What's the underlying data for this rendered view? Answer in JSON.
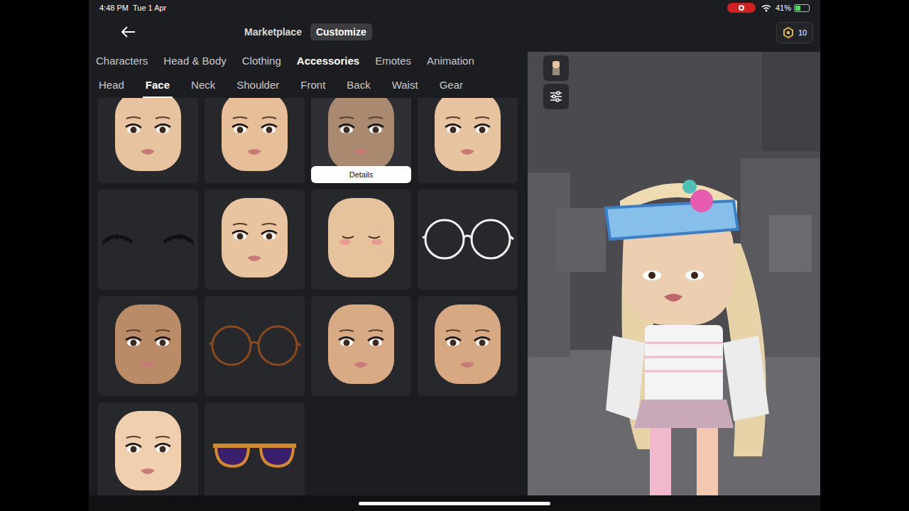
{
  "status_bar": {
    "time": "4:48 PM",
    "date": "Tue 1 Apr",
    "battery": "41%",
    "battery_level": 0.41,
    "recording": true
  },
  "header": {
    "modes": [
      {
        "label": "Marketplace",
        "selected": false
      },
      {
        "label": "Customize",
        "selected": true
      }
    ],
    "robux": "10"
  },
  "categories": [
    {
      "label": "Characters",
      "selected": false
    },
    {
      "label": "Head & Body",
      "selected": false
    },
    {
      "label": "Clothing",
      "selected": false
    },
    {
      "label": "Accessories",
      "selected": true
    },
    {
      "label": "Emotes",
      "selected": false
    },
    {
      "label": "Animation",
      "selected": false
    }
  ],
  "subcategories": [
    {
      "label": "Head",
      "selected": false
    },
    {
      "label": "Face",
      "selected": true
    },
    {
      "label": "Neck",
      "selected": false
    },
    {
      "label": "Shoulder",
      "selected": false
    },
    {
      "label": "Front",
      "selected": false
    },
    {
      "label": "Back",
      "selected": false
    },
    {
      "label": "Waist",
      "selected": false
    },
    {
      "label": "Gear",
      "selected": false
    }
  ],
  "details_button": "Details",
  "items": [
    {
      "kind": "face",
      "color": "#e8c3a0",
      "selected": false
    },
    {
      "kind": "face",
      "color": "#e6bf98",
      "selected": false
    },
    {
      "kind": "face",
      "color": "#a98a70",
      "selected": true
    },
    {
      "kind": "face",
      "color": "#e8c3a0",
      "selected": false
    },
    {
      "kind": "lashes",
      "color": "#111111",
      "selected": false
    },
    {
      "kind": "face",
      "color": "#e9c4a0",
      "selected": false
    },
    {
      "kind": "closed",
      "color": "#e6c29d",
      "selected": false
    },
    {
      "kind": "glasses",
      "color": "#f2f2f2",
      "selected": false
    },
    {
      "kind": "face",
      "color": "#b98b66",
      "selected": false
    },
    {
      "kind": "glasses",
      "color": "#8a4a1e",
      "selected": false
    },
    {
      "kind": "face",
      "color": "#d9ab85",
      "selected": false
    },
    {
      "kind": "face",
      "color": "#d7a982",
      "selected": false
    },
    {
      "kind": "face",
      "color": "#f0cfae",
      "selected": false
    },
    {
      "kind": "sunglasses",
      "color": "#d48a2a",
      "selected": false
    }
  ]
}
